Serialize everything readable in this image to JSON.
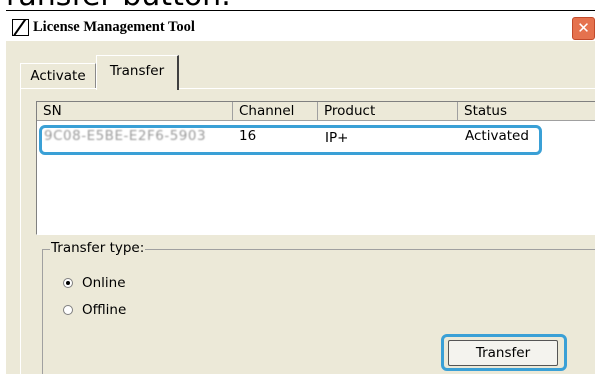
{
  "caption": {
    "text": "ransfer button."
  },
  "window": {
    "title": "License Management Tool",
    "close_glyph": "✕"
  },
  "tabs": [
    {
      "label": "Activate",
      "selected": false
    },
    {
      "label": "Transfer",
      "selected": true
    }
  ],
  "license_list": {
    "columns": [
      "SN",
      "Channel",
      "Product",
      "Status"
    ],
    "rows": [
      {
        "sn": "9C08-E5BE-E2F6-5903",
        "channel": "16",
        "product": "IP+",
        "status": "Activated"
      }
    ]
  },
  "transfer_type": {
    "legend": "Transfer type:",
    "options": [
      {
        "label": "Online",
        "selected": true
      },
      {
        "label": "Offline",
        "selected": false
      }
    ]
  },
  "actions": {
    "transfer_label": "Transfer"
  },
  "colors": {
    "highlight": "#3aa0d6",
    "window_bg": "#ece9d8",
    "close_button": "#e5724e"
  }
}
